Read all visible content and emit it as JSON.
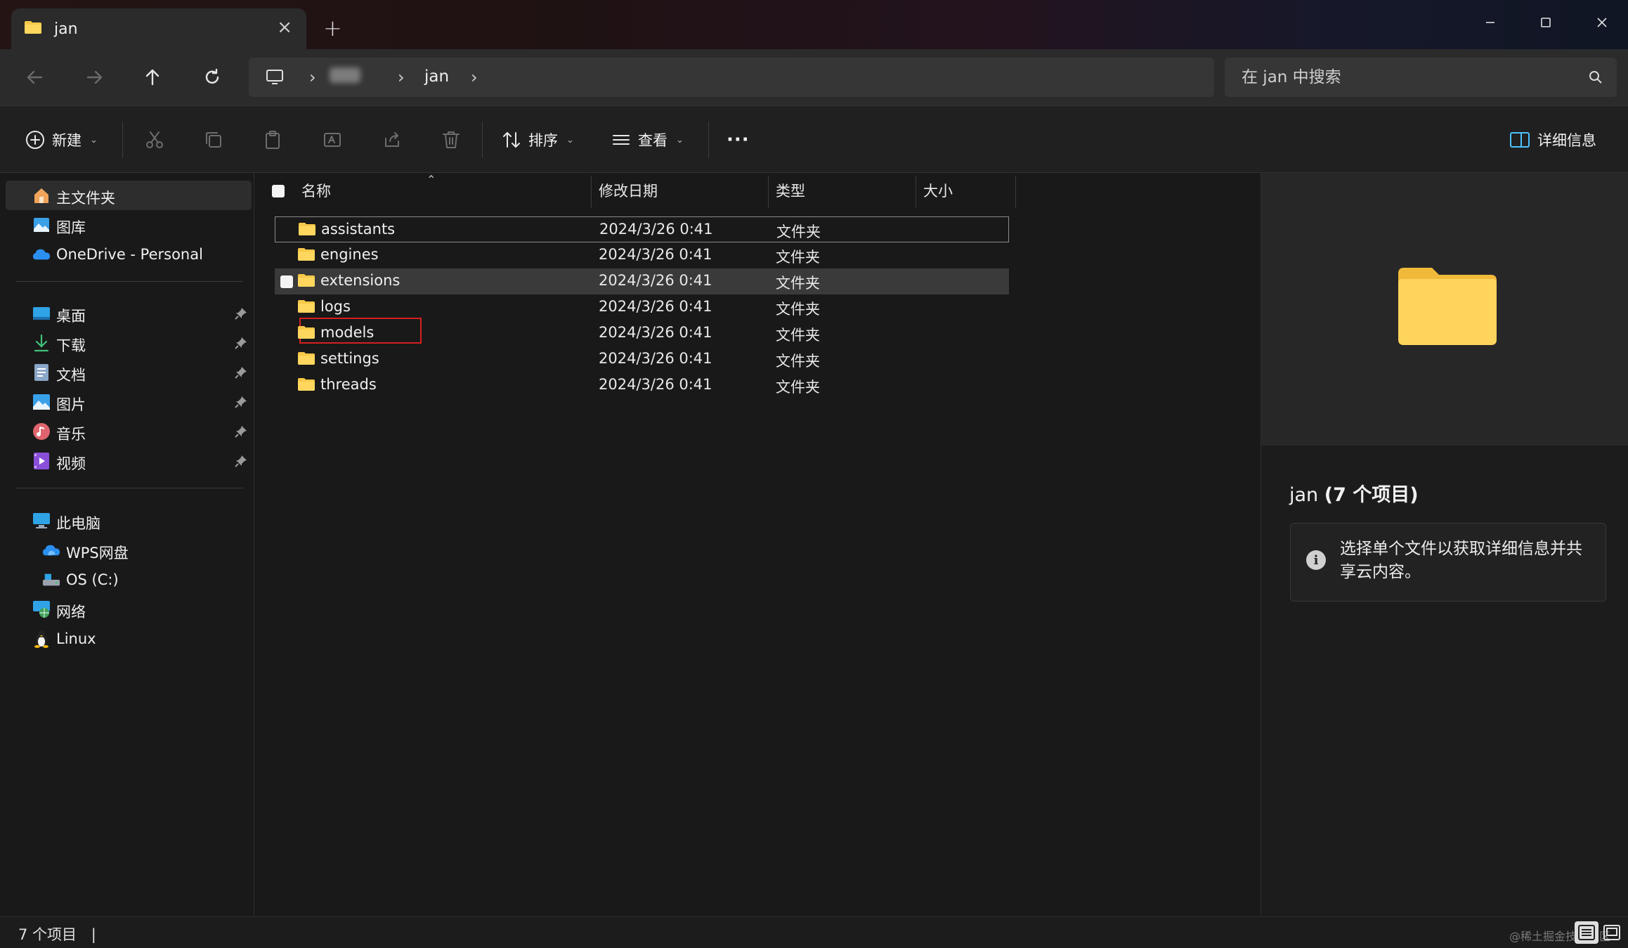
{
  "tab": {
    "title": "jan"
  },
  "address": {
    "crumb": "jan"
  },
  "search": {
    "placeholder": "在 jan 中搜索"
  },
  "toolbar": {
    "new_label": "新建",
    "sort_label": "排序",
    "view_label": "查看",
    "more_label": "···",
    "details_label": "详细信息"
  },
  "sidebar": {
    "quick": [
      {
        "label": "主文件夹",
        "icon": "home-icon"
      },
      {
        "label": "图库",
        "icon": "gallery-icon"
      },
      {
        "label": "OneDrive - Personal",
        "icon": "onedrive-cloud-icon"
      }
    ],
    "pinned": [
      {
        "label": "桌面",
        "icon": "desktop-icon"
      },
      {
        "label": "下载",
        "icon": "download-icon"
      },
      {
        "label": "文档",
        "icon": "document-icon"
      },
      {
        "label": "图片",
        "icon": "pictures-icon"
      },
      {
        "label": "音乐",
        "icon": "music-icon"
      },
      {
        "label": "视频",
        "icon": "video-icon"
      }
    ],
    "devices": [
      {
        "label": "此电脑",
        "icon": "this-pc-icon"
      },
      {
        "label": "WPS网盘",
        "icon": "wps-cloud-icon"
      },
      {
        "label": "OS (C:)",
        "icon": "drive-icon"
      },
      {
        "label": "网络",
        "icon": "network-icon"
      },
      {
        "label": "Linux",
        "icon": "linux-penguin-icon"
      }
    ]
  },
  "columns": {
    "name": "名称",
    "date": "修改日期",
    "type": "类型",
    "size": "大小"
  },
  "files": [
    {
      "name": "assistants",
      "date": "2024/3/26 0:41",
      "type": "文件夹"
    },
    {
      "name": "engines",
      "date": "2024/3/26 0:41",
      "type": "文件夹"
    },
    {
      "name": "extensions",
      "date": "2024/3/26 0:41",
      "type": "文件夹"
    },
    {
      "name": "logs",
      "date": "2024/3/26 0:41",
      "type": "文件夹"
    },
    {
      "name": "models",
      "date": "2024/3/26 0:41",
      "type": "文件夹"
    },
    {
      "name": "settings",
      "date": "2024/3/26 0:41",
      "type": "文件夹"
    },
    {
      "name": "threads",
      "date": "2024/3/26 0:41",
      "type": "文件夹"
    }
  ],
  "details": {
    "folder_name": "jan",
    "item_count": "(7 个项目)",
    "info": "选择单个文件以获取详细信息并共享云内容。"
  },
  "status": {
    "count": "7 个项目",
    "separator": "|",
    "watermark": "@稀土掘金技术社区"
  },
  "colors": {
    "folder": "#f7c948",
    "accent": "#4cc2ff",
    "highlight_box": "#d81f1f"
  }
}
